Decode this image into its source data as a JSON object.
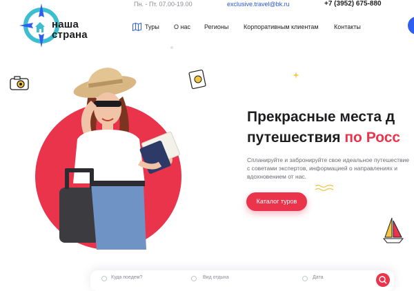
{
  "topbar": {
    "hours": "Пн. - Пт. 07.00-19.00",
    "email": "exclusive.travel@bk.ru",
    "phone": "+7 (3952) 675-880"
  },
  "logo": {
    "line1": "наша",
    "line2": "страна"
  },
  "nav": {
    "items": [
      {
        "label": "Туры",
        "icon": "map-icon"
      },
      {
        "label": "О нас"
      },
      {
        "label": "Регионы"
      },
      {
        "label": "Корпоративным клиентам"
      },
      {
        "label": "Контакты"
      }
    ]
  },
  "hero": {
    "title_line1": "Прекрасные места д",
    "title_line2_plain": "путешествия ",
    "title_line2_accent": "по Росс",
    "description": "Спланируйте и забронируйте свое идеальное путешествие с советами экспертов, информацией о направлениях и вдохновением от нас.",
    "cta_label": "Каталог туров"
  },
  "search": {
    "destination_placeholder": "Куда поедем?",
    "type_placeholder": "Вид отдыха",
    "date_placeholder": "Дата"
  },
  "colors": {
    "accent": "#e9344c",
    "link": "#2b55e0",
    "brand_blue": "#2f5ef0",
    "logo_teal": "#3bbfd0",
    "text": "#1d1d1f",
    "muted": "#6b6b74"
  },
  "icons": [
    "compass-logo-icon",
    "map-icon",
    "camera-icon",
    "passport-stamp-icon",
    "wave-icon",
    "sailboat-icon",
    "search-icon"
  ]
}
